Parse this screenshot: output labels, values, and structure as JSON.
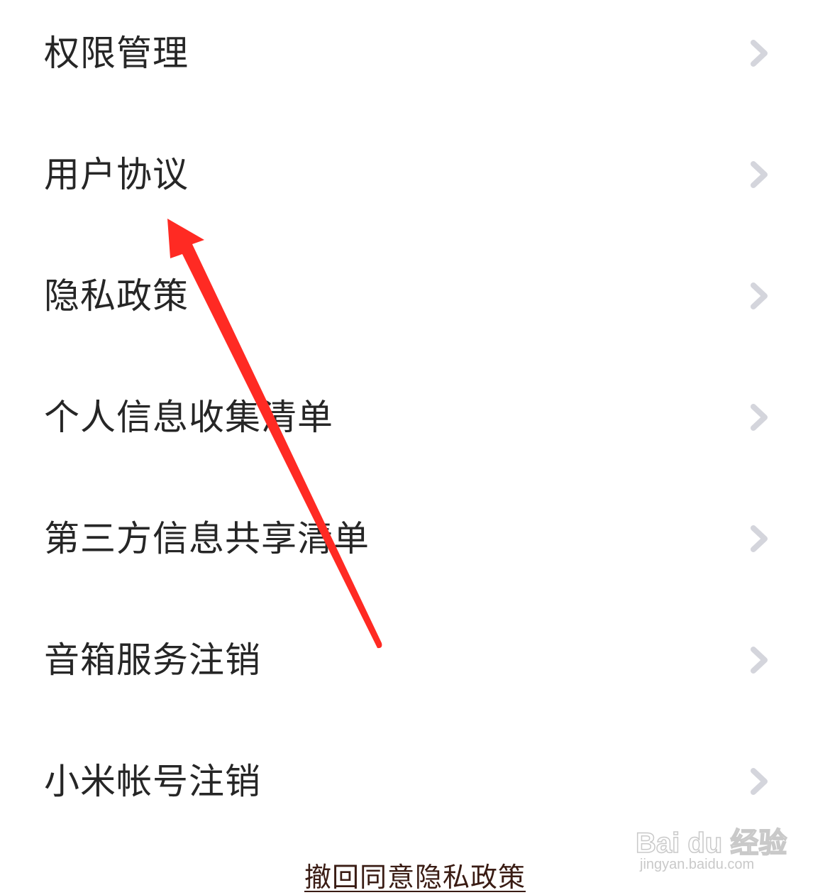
{
  "menu": {
    "items": [
      {
        "label": "权限管理"
      },
      {
        "label": "用户协议"
      },
      {
        "label": "隐私政策"
      },
      {
        "label": "个人信息收集清单"
      },
      {
        "label": "第三方信息共享清单"
      },
      {
        "label": "音箱服务注销"
      },
      {
        "label": "小米帐号注销"
      }
    ]
  },
  "footer": {
    "revoke_link": "撤回同意隐私政策"
  },
  "watermark": {
    "brand": "Bai du 经验",
    "url": "jingyan.baidu.com"
  },
  "colors": {
    "text": "#262626",
    "chevron": "#d4d5dc",
    "link": "#3a1c14",
    "annotation_arrow": "#ff2a23"
  },
  "icons": {
    "chevron": "chevron-right-icon"
  }
}
